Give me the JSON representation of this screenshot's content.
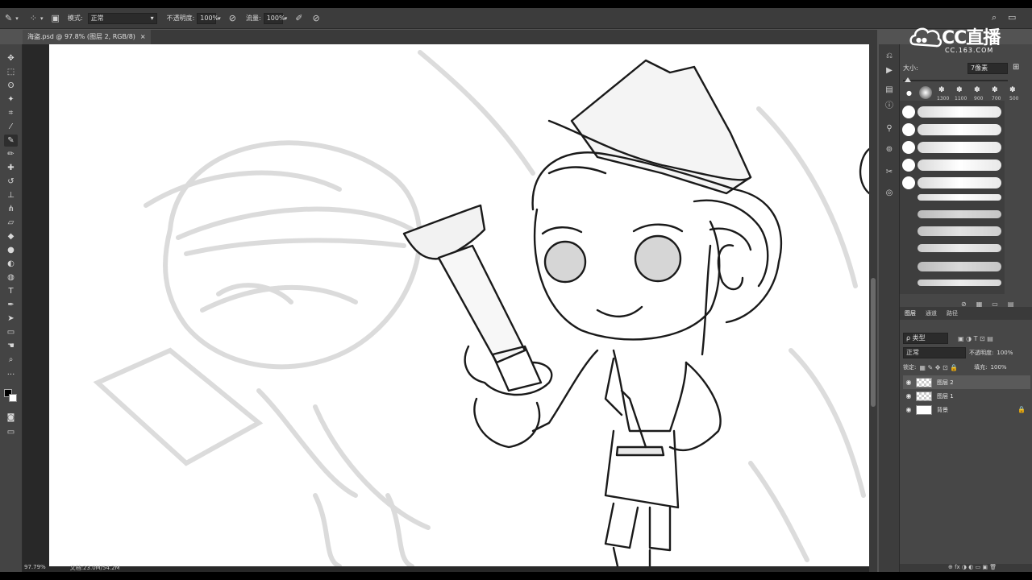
{
  "options_bar": {
    "mode_label": "模式:",
    "mode_value": "正常",
    "opacity_label": "不透明度:",
    "opacity_value": "100%",
    "flow_label": "流量:",
    "flow_value": "100%"
  },
  "document": {
    "tab_title": "海盗.psd @ 97.8% (图层 2, RGB/8)",
    "close": "×"
  },
  "status": {
    "zoom": "97.79%",
    "doc_info": "文档:23.0M/54.2M"
  },
  "logo": {
    "text": "CC直播",
    "url": "CC.163.COM"
  },
  "brush_panel": {
    "size_label": "大小:",
    "size_value": "7像素",
    "presets": [
      "1300",
      "1100",
      "900",
      "700",
      "500"
    ]
  },
  "layers_panel": {
    "tabs": [
      "图层",
      "通道",
      "路径"
    ],
    "filter_label": "ρ 类型",
    "blend_mode": "正常",
    "opacity_label": "不透明度:",
    "opacity_value": "100%",
    "lock_label": "锁定:",
    "fill_label": "填充:",
    "fill_value": "100%",
    "layers": [
      {
        "name": "图层 2"
      },
      {
        "name": "图层 1"
      },
      {
        "name": "背景"
      }
    ],
    "footer_icons": "⊕ fx ◑ ◐ ▭ ▣ 🗑"
  },
  "colors": {
    "accent": "#ffffff",
    "panel": "#474747",
    "canvas_bg": "#282828"
  }
}
